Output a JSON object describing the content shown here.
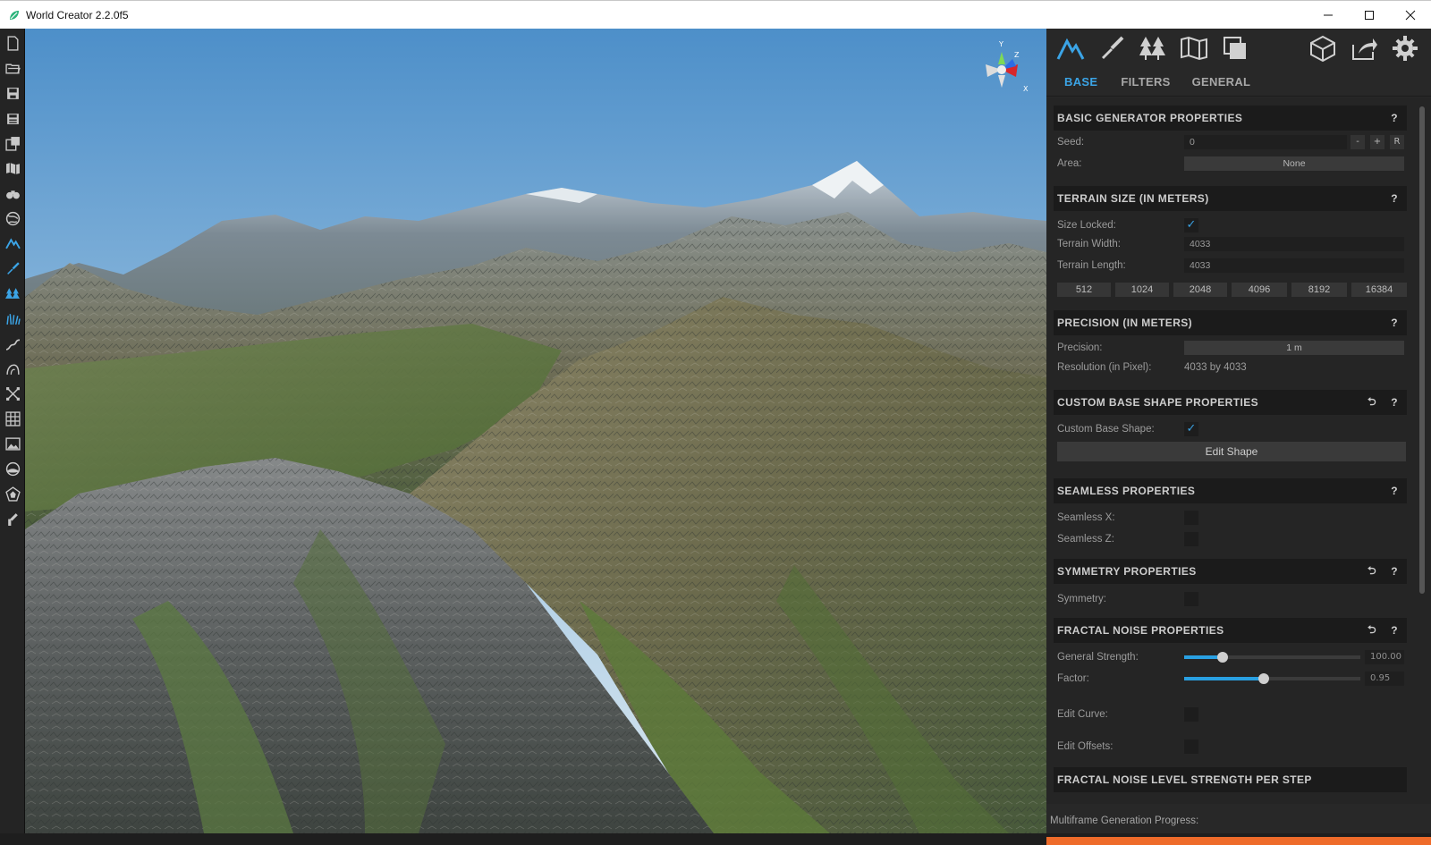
{
  "window": {
    "title": "World Creator 2.2.0f5",
    "controls": [
      "minimize-icon",
      "maximize-icon",
      "close-icon"
    ]
  },
  "left_toolbar": {
    "tools": [
      {
        "name": "new-file",
        "icon": "new-file-icon"
      },
      {
        "name": "open-file",
        "icon": "folder-open-icon"
      },
      {
        "name": "save",
        "icon": "save-icon"
      },
      {
        "name": "save-as",
        "icon": "save-as-icon"
      },
      {
        "name": "export",
        "icon": "export-icon"
      },
      {
        "name": "map",
        "icon": "map-icon"
      },
      {
        "name": "camera",
        "icon": "binoculars-icon"
      },
      {
        "name": "globe",
        "icon": "globe-icon"
      },
      {
        "name": "terrain",
        "icon": "mountain-icon",
        "active": true
      },
      {
        "name": "brush",
        "icon": "brush-icon"
      },
      {
        "name": "vegetation",
        "icon": "forest-icon"
      },
      {
        "name": "grass",
        "icon": "grass-icon"
      },
      {
        "name": "river",
        "icon": "river-icon"
      },
      {
        "name": "erosion",
        "icon": "erosion-icon"
      },
      {
        "name": "transform",
        "icon": "transform-icon"
      },
      {
        "name": "grid",
        "icon": "grid-icon"
      },
      {
        "name": "image",
        "icon": "image-icon"
      },
      {
        "name": "environment",
        "icon": "sky-icon"
      },
      {
        "name": "asset",
        "icon": "pentagon-icon"
      },
      {
        "name": "tools",
        "icon": "wrench-icon"
      }
    ]
  },
  "gizmo": {
    "y_label": "Y",
    "z_label": "Z",
    "x_label": "X"
  },
  "panel": {
    "top_tools": [
      "mountain-icon",
      "brush-icon",
      "forest-icon",
      "map-icon",
      "layers-icon"
    ],
    "top_right_tools": [
      "cube-icon",
      "share-icon",
      "gear-icon"
    ],
    "tabs": [
      {
        "label": "BASE",
        "active": true
      },
      {
        "label": "FILTERS",
        "active": false
      },
      {
        "label": "GENERAL",
        "active": false
      }
    ],
    "sections": {
      "basic": {
        "title": "BASIC GENERATOR PROPERTIES",
        "help": "?",
        "seed_label": "Seed:",
        "seed_value": "0",
        "seed_minus": "-",
        "seed_plus": "+",
        "seed_random": "R",
        "area_label": "Area:",
        "area_value": "None"
      },
      "terrain_size": {
        "title": "TERRAIN SIZE (IN METERS)",
        "help": "?",
        "size_locked_label": "Size Locked:",
        "size_locked": true,
        "width_label": "Terrain Width:",
        "width_value": "4033",
        "length_label": "Terrain Length:",
        "length_value": "4033",
        "presets": [
          "512",
          "1024",
          "2048",
          "4096",
          "8192",
          "16384"
        ]
      },
      "precision": {
        "title": "PRECISION (IN METERS)",
        "help": "?",
        "precision_label": "Precision:",
        "precision_value": "1 m",
        "resolution_label": "Resolution (in Pixel):",
        "resolution_value": "4033 by 4033"
      },
      "custom_shape": {
        "title": "CUSTOM BASE SHAPE PROPERTIES",
        "help": "?",
        "checkbox_label": "Custom Base Shape:",
        "enabled": true,
        "edit_button": "Edit Shape"
      },
      "seamless": {
        "title": "SEAMLESS PROPERTIES",
        "help": "?",
        "x_label": "Seamless X:",
        "z_label": "Seamless Z:"
      },
      "symmetry": {
        "title": "SYMMETRY PROPERTIES",
        "help": "?",
        "symmetry_label": "Symmetry:"
      },
      "fractal": {
        "title": "FRACTAL NOISE PROPERTIES",
        "help": "?",
        "strength_label": "General Strength:",
        "strength_value": "100.00",
        "strength_fraction": 0.22,
        "factor_label": "Factor:",
        "factor_value": "0.95",
        "factor_fraction": 0.45,
        "curve_label": "Edit Curve:",
        "offsets_label": "Edit Offsets:"
      },
      "fractal_level": {
        "title": "FRACTAL NOISE LEVEL STRENGTH PER STEP"
      }
    },
    "progress_label": "Multiframe Generation Progress:",
    "colors": {
      "accent": "#3ba4e6",
      "progress": "#ee6b2a",
      "panel_bg": "#282828"
    }
  }
}
